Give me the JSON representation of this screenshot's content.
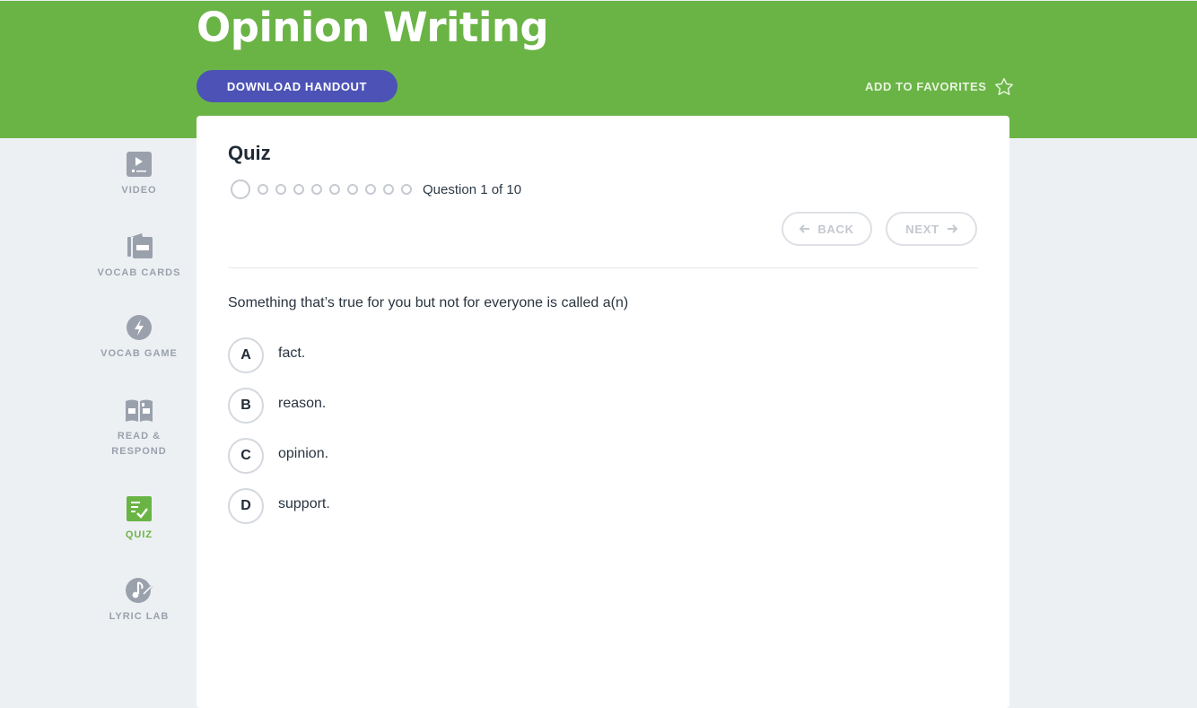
{
  "header": {
    "title": "Opinion Writing",
    "download_label": "DOWNLOAD HANDOUT",
    "favorites_label": "ADD TO FAVORITES"
  },
  "sidebar": {
    "items": [
      {
        "label": "VIDEO",
        "icon": "video-icon"
      },
      {
        "label": "VOCAB CARDS",
        "icon": "vocab-cards-icon"
      },
      {
        "label": "VOCAB GAME",
        "icon": "lightning-icon"
      },
      {
        "label_line1": "READ &",
        "label_line2": "RESPOND",
        "icon": "open-book-icon"
      },
      {
        "label": "QUIZ",
        "icon": "quiz-checklist-icon",
        "active": true
      },
      {
        "label": "LYRIC LAB",
        "icon": "music-note-icon"
      }
    ]
  },
  "quiz": {
    "title": "Quiz",
    "progress_text": "Question 1 of 10",
    "current_question": 1,
    "total_questions": 10,
    "back_label": "BACK",
    "next_label": "NEXT",
    "question": "Something that’s true for you but not for everyone is called a(n)",
    "answers": [
      {
        "letter": "A",
        "text": "fact."
      },
      {
        "letter": "B",
        "text": "reason."
      },
      {
        "letter": "C",
        "text": "opinion."
      },
      {
        "letter": "D",
        "text": "support."
      }
    ]
  },
  "colors": {
    "header_green": "#6ab446",
    "button_blue": "#4c52b6",
    "sidebar_gray": "#9aa1ad",
    "background": "#edf0f3"
  }
}
